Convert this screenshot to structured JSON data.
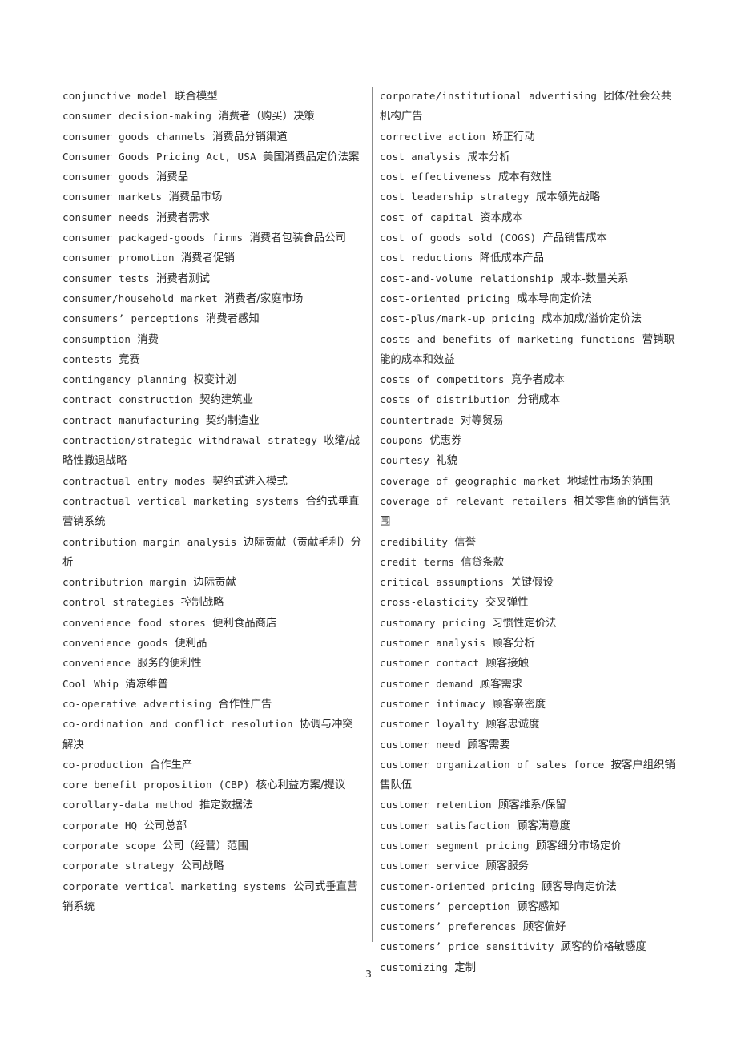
{
  "document": {
    "page_number": "3",
    "columns": {
      "left": [
        {
          "term": "conjunctive model",
          "translation": "联合模型"
        },
        {
          "term": "consumer decision-making",
          "translation": "消费者（购买）决策"
        },
        {
          "term": "consumer goods channels",
          "translation": "消费品分销渠道"
        },
        {
          "term": "Consumer Goods Pricing Act, USA",
          "translation": "美国消费品定价法案"
        },
        {
          "term": "consumer goods",
          "translation": "消费品"
        },
        {
          "term": "consumer markets",
          "translation": "消费品市场"
        },
        {
          "term": "consumer needs",
          "translation": "消费者需求"
        },
        {
          "term": "consumer packaged-goods firms",
          "translation": "消费者包装食品公司"
        },
        {
          "term": "consumer promotion",
          "translation": "消费者促销"
        },
        {
          "term": "consumer tests",
          "translation": "消费者测试"
        },
        {
          "term": "consumer/household market",
          "translation": "消费者/家庭市场"
        },
        {
          "term": "consumers’ perceptions",
          "translation": "消费者感知"
        },
        {
          "term": "consumption",
          "translation": "消费"
        },
        {
          "term": "contests",
          "translation": "竞赛"
        },
        {
          "term": "contingency planning",
          "translation": "权变计划"
        },
        {
          "term": "contract construction",
          "translation": "契约建筑业"
        },
        {
          "term": "contract manufacturing",
          "translation": "契约制造业"
        },
        {
          "term": "contraction/strategic withdrawal strategy",
          "translation": "收缩/战略性撤退战略"
        },
        {
          "term": "contractual entry modes",
          "translation": "契约式进入模式"
        },
        {
          "term": "contractual vertical marketing systems",
          "translation": "合约式垂直营销系统"
        },
        {
          "term": "contribution margin analysis",
          "translation": "边际贡献（贡献毛利）分析"
        },
        {
          "term": "contributrion margin",
          "translation": "边际贡献"
        },
        {
          "term": "control strategies",
          "translation": "控制战略"
        },
        {
          "term": "convenience food stores",
          "translation": "便利食品商店"
        },
        {
          "term": "convenience goods",
          "translation": "便利品"
        },
        {
          "term": "convenience",
          "translation": "服务的便利性"
        },
        {
          "term": "Cool Whip",
          "translation": "清凉维普"
        },
        {
          "term": "co-operative advertising",
          "translation": "合作性广告"
        },
        {
          "term": "co-ordination and conflict resolution",
          "translation": "协调与冲突解决"
        },
        {
          "term": "co-production",
          "translation": "合作生产"
        },
        {
          "term": "core benefit proposition (CBP)",
          "translation": "核心利益方案/提议"
        },
        {
          "term": "corollary-data method",
          "translation": "推定数据法"
        },
        {
          "term": "corporate HQ",
          "translation": "公司总部"
        },
        {
          "term": "corporate scope",
          "translation": "公司（经营）范围"
        },
        {
          "term": "corporate strategy",
          "translation": "公司战略"
        },
        {
          "term": "corporate vertical marketing systems",
          "translation": "公司式垂直营销系统"
        }
      ],
      "right": [
        {
          "term": "corporate/institutional advertising",
          "translation": "团体/社会公共机构广告"
        },
        {
          "term": "corrective action",
          "translation": "矫正行动"
        },
        {
          "term": "cost analysis",
          "translation": "成本分析"
        },
        {
          "term": "cost effectiveness",
          "translation": "成本有效性"
        },
        {
          "term": "cost leadership strategy",
          "translation": "成本领先战略"
        },
        {
          "term": "cost of capital",
          "translation": "资本成本"
        },
        {
          "term": "cost of goods sold (COGS)",
          "translation": "产品销售成本"
        },
        {
          "term": "cost reductions",
          "translation": "降低成本产品"
        },
        {
          "term": "cost-and-volume relationship",
          "translation": "成本-数量关系"
        },
        {
          "term": "cost-oriented pricing",
          "translation": "成本导向定价法"
        },
        {
          "term": "cost-plus/mark-up pricing",
          "translation": "成本加成/溢价定价法"
        },
        {
          "term": "costs and benefits of marketing functions",
          "translation": "营销职能的成本和效益"
        },
        {
          "term": "costs of competitors",
          "translation": "竞争者成本"
        },
        {
          "term": "costs of distribution",
          "translation": "分销成本"
        },
        {
          "term": "countertrade",
          "translation": "对等贸易"
        },
        {
          "term": "coupons",
          "translation": "优惠券"
        },
        {
          "term": "courtesy",
          "translation": "礼貌"
        },
        {
          "term": "coverage of geographic market",
          "translation": "地域性市场的范围"
        },
        {
          "term": "coverage of relevant retailers",
          "translation": "相关零售商的销售范围"
        },
        {
          "term": "credibility",
          "translation": "信誉"
        },
        {
          "term": "credit terms",
          "translation": "信贷条款"
        },
        {
          "term": "critical assumptions",
          "translation": "关键假设"
        },
        {
          "term": "cross-elasticity",
          "translation": "交叉弹性"
        },
        {
          "term": "customary pricing",
          "translation": "习惯性定价法"
        },
        {
          "term": "customer analysis",
          "translation": "顾客分析"
        },
        {
          "term": "customer contact",
          "translation": "顾客接触"
        },
        {
          "term": "customer demand",
          "translation": "顾客需求"
        },
        {
          "term": "customer intimacy",
          "translation": "顾客亲密度"
        },
        {
          "term": "customer loyalty",
          "translation": "顾客忠诚度"
        },
        {
          "term": "customer need",
          "translation": "顾客需要"
        },
        {
          "term": "customer organization of sales force",
          "translation": "按客户组织销售队伍"
        },
        {
          "term": "customer retention",
          "translation": "顾客维系/保留"
        },
        {
          "term": "customer satisfaction",
          "translation": "顾客满意度"
        },
        {
          "term": "customer segment pricing",
          "translation": "顾客细分市场定价"
        },
        {
          "term": "customer service",
          "translation": "顾客服务"
        },
        {
          "term": "customer-oriented pricing",
          "translation": "顾客导向定价法"
        },
        {
          "term": "customers’ perception",
          "translation": "顾客感知"
        },
        {
          "term": "customers’ preferences",
          "translation": "顾客偏好"
        },
        {
          "term": "customers’ price sensitivity",
          "translation": "顾客的价格敏感度"
        },
        {
          "term": "customizing",
          "translation": "定制"
        }
      ]
    }
  }
}
